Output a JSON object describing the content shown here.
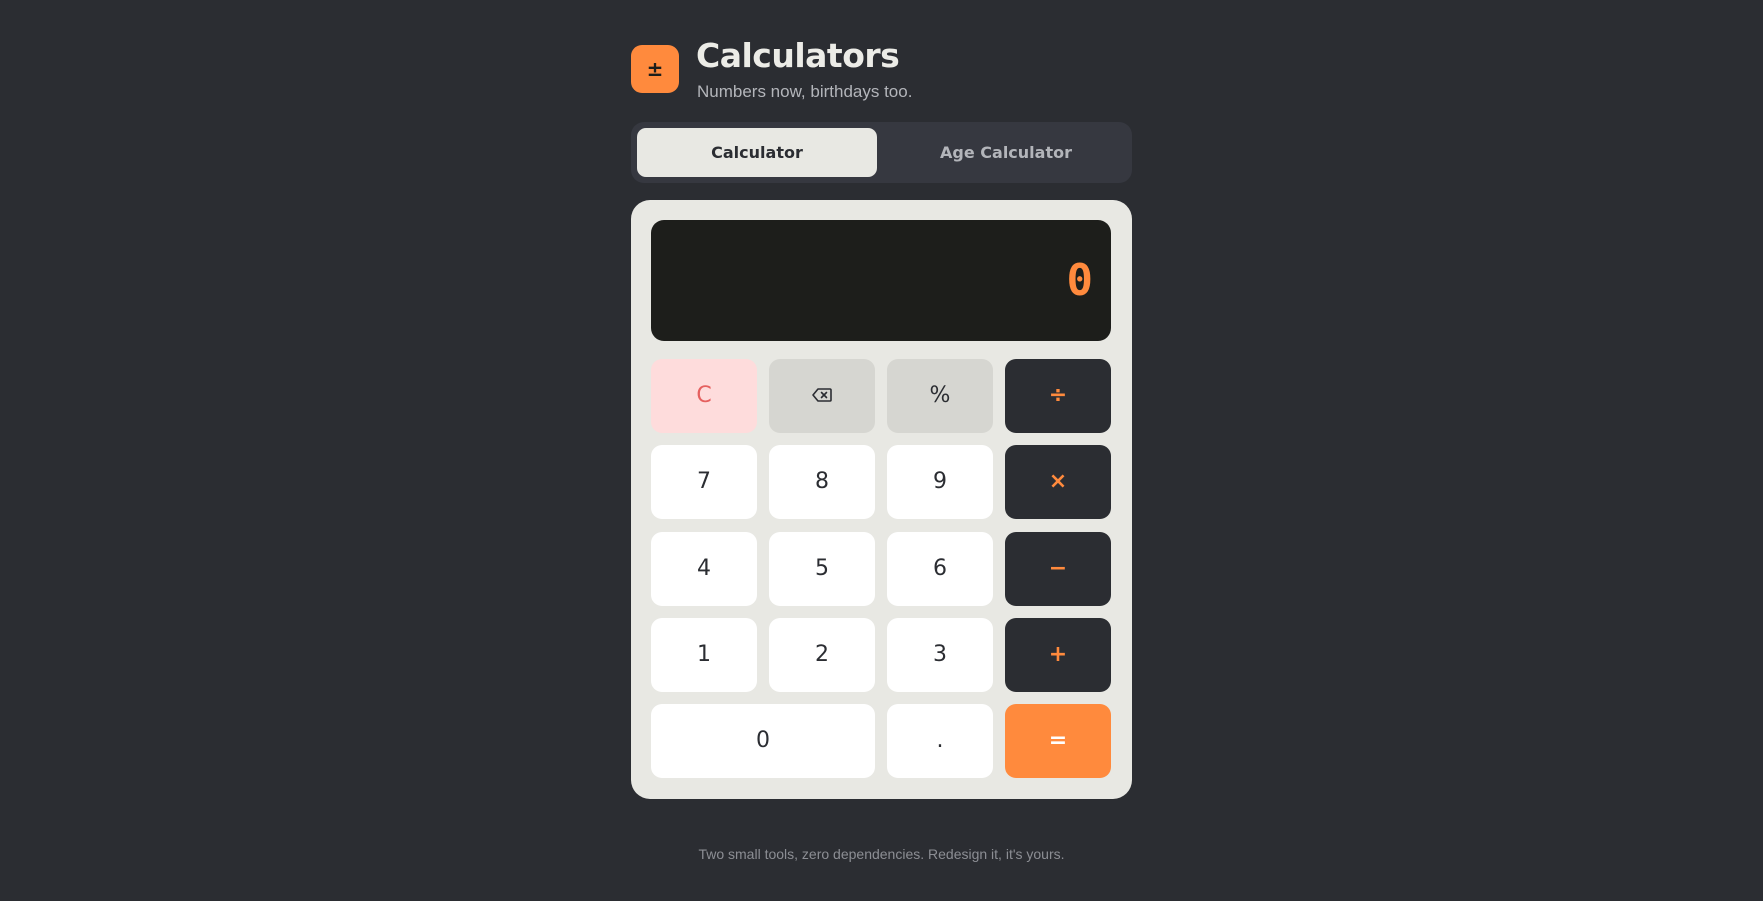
{
  "header": {
    "logo_glyph": "±",
    "title": "Calculators",
    "subtitle": "Numbers now, birthdays too."
  },
  "tabs": [
    {
      "label": "Calculator",
      "active": true
    },
    {
      "label": "Age Calculator",
      "active": false
    }
  ],
  "calculator": {
    "display": "0",
    "keys": {
      "clear": "C",
      "backspace_icon": "backspace-icon",
      "percent": "%",
      "divide": "÷",
      "seven": "7",
      "eight": "8",
      "nine": "9",
      "multiply": "×",
      "four": "4",
      "five": "5",
      "six": "6",
      "subtract": "−",
      "one": "1",
      "two": "2",
      "three": "3",
      "add": "+",
      "zero": "0",
      "decimal": ".",
      "equals": "="
    }
  },
  "footer": {
    "text": "Two small tools, zero dependencies. Redesign it, it's yours."
  },
  "colors": {
    "background": "#2b2d32",
    "accent": "#ff8a3d",
    "panel": "#e8e8e3",
    "display": "#1d1e1b",
    "clear_bg": "#fedcdc",
    "clear_text": "#e5605f"
  }
}
